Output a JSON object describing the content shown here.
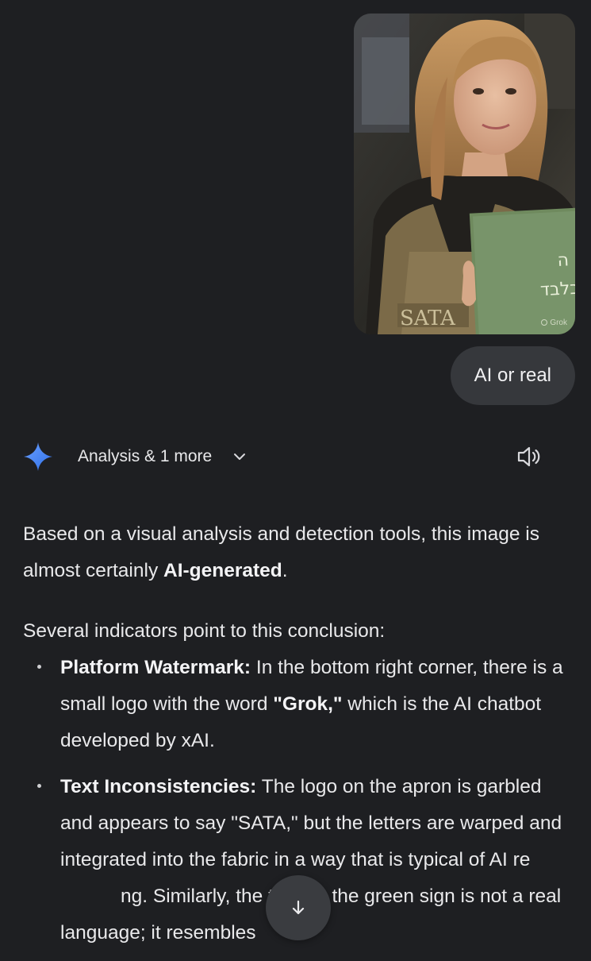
{
  "attached_image": {
    "sign_text_line1": "ה",
    "sign_text_line2": "בלבד",
    "apron_logo": "SATA",
    "watermark": "Grok"
  },
  "user_message": "AI or real",
  "assistant": {
    "tools_label": "Analysis & 1 more",
    "icons": {
      "logo": "gemini-sparkle-icon",
      "expand": "chevron-down-icon",
      "read_aloud": "speaker-icon",
      "scroll": "arrow-down-icon"
    },
    "accent_colors": [
      "#4f8bf7",
      "#2f6fe8"
    ],
    "intro_prefix": "Based on a visual analysis and detection tools, this image is almost certainly ",
    "intro_bold": "AI-generated",
    "intro_suffix": ".",
    "lead": "Several indicators point to this conclusion:",
    "bullets": [
      {
        "title": "Platform Watermark:",
        "text_a": " In the bottom right corner, there is a small logo with the word ",
        "bold_word": "\"Grok,\"",
        "text_b": " which is the AI chatbot developed by xAI."
      },
      {
        "title": "Text Inconsistencies:",
        "text_a": " The logo on the apron is garbled and appears to say \"SATA,\" but the letters are warped and integrated into the fabric in a way that is typical of AI re",
        "text_b": "ng. Similarly, the text on the green sign is not a real language; it resembles"
      }
    ]
  }
}
